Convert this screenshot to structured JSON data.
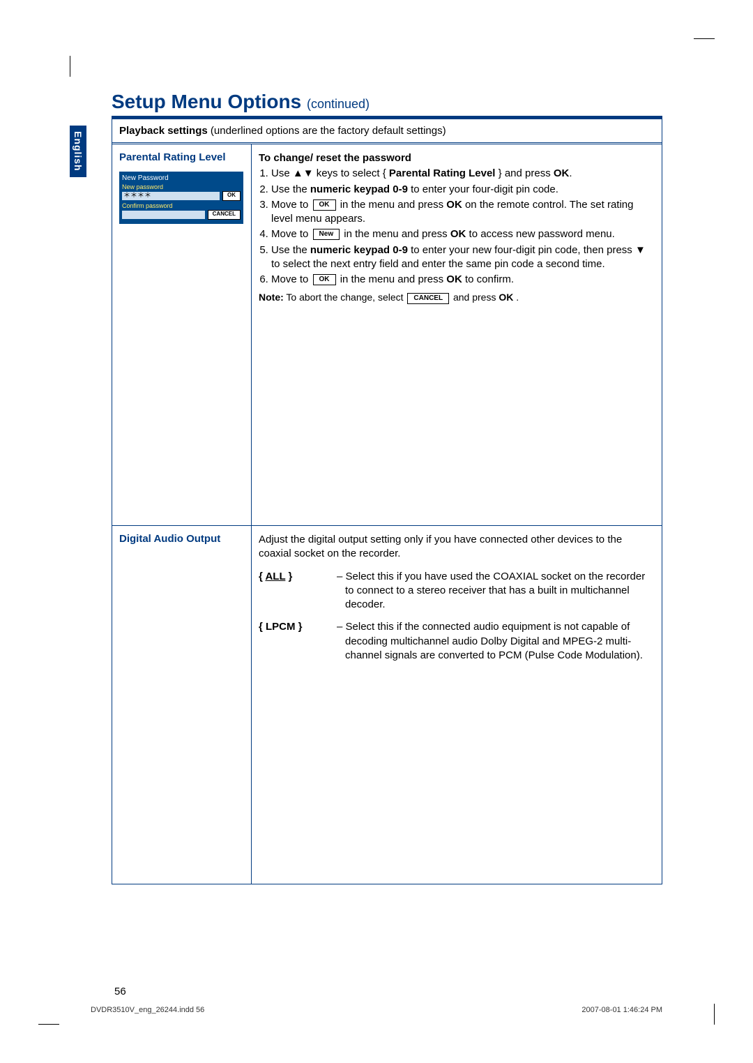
{
  "title_main": "Setup Menu Options ",
  "title_cont": "(continued)",
  "lang_tab": "English",
  "panel_header_bold": "Playback settings",
  "panel_header_rest": " (underlined options are the factory default settings)",
  "section1": {
    "heading": "Parental Rating Level",
    "mini": {
      "title": "New Password",
      "label1": "New password",
      "value1": "＊＊＊＊",
      "btn1": "OK",
      "label2": "Confirm password",
      "value2": "",
      "btn2": "CANCEL"
    },
    "right_heading": "To change/ reset the password",
    "steps": {
      "s1a": "Use ▲▼ keys to select { ",
      "s1b": "Parental Rating Level",
      "s1c": " } and press ",
      "s1d": "OK",
      "s1e": ".",
      "s2a": "Use the ",
      "s2b": "numeric keypad 0-9",
      "s2c": " to enter your four-digit pin code.",
      "s3a": "Move to ",
      "s3chip": "OK",
      "s3b": " in the menu and press ",
      "s3c": "OK",
      "s3d": " on the remote control.  The set rating level menu appears.",
      "s4a": "Move to ",
      "s4chip": "New",
      "s4b": " in the menu and press ",
      "s4c": "OK",
      "s4d": " to access new password menu.",
      "s5a": "Use the ",
      "s5b": "numeric keypad 0-9",
      "s5c": " to enter your new four-digit pin code, then press ▼ to select the next entry field and enter the same pin code a second time.",
      "s6a": "Move to ",
      "s6chip": "OK",
      "s6b": " in the menu and press ",
      "s6c": "OK",
      "s6d": " to confirm."
    },
    "note_bold": "Note:",
    "note_a": "  To abort the change, select ",
    "note_chip": "CANCEL",
    "note_b": " and press ",
    "note_c": "OK",
    "note_d": " ."
  },
  "section2": {
    "heading": "Digital Audio Output",
    "intro": "Adjust the digital output setting only if you have connected other devices to the coaxial socket on the recorder.",
    "opt1_label": "ALL",
    "opt1_desc": "–  Select this if you have used the COAXIAL socket on the recorder to connect to a stereo receiver that has a built in multichannel decoder.",
    "opt2_label": "LPCM",
    "opt2_desc": "–  Select this if the connected audio equipment is not capable of decoding multichannel audio Dolby Digital and MPEG-2 multi-channel signals are converted to PCM (Pulse Code Modulation)."
  },
  "page_number": "56",
  "footer_left": "DVDR3510V_eng_26244.indd   56",
  "footer_right": "2007-08-01   1:46:24 PM"
}
